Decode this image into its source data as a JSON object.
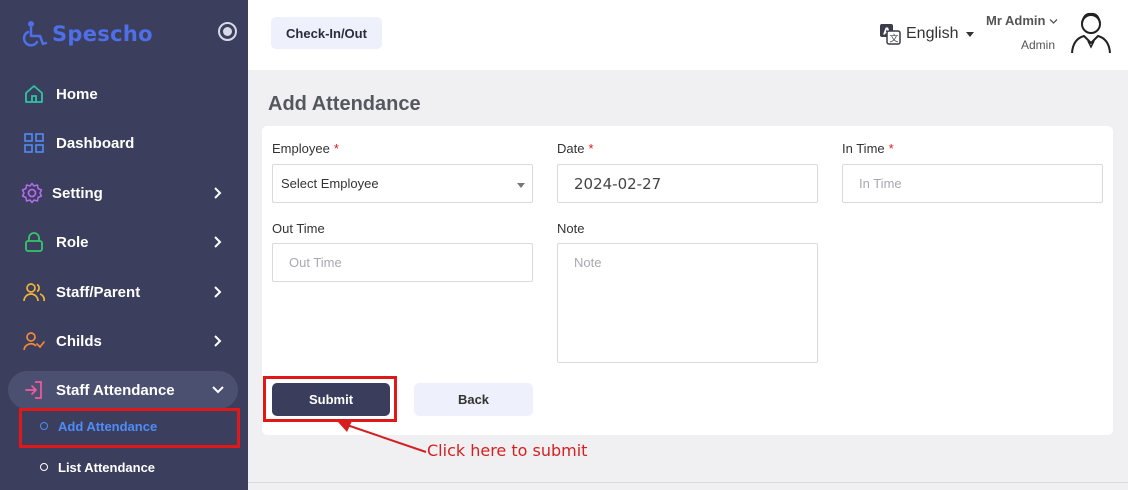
{
  "brand": {
    "name": "Spescho",
    "logo_icon": "wheelchair-icon",
    "accent": "#4f6fe8"
  },
  "sidebar": {
    "items": [
      {
        "label": "Home",
        "icon": "home-icon",
        "color": "#2ec4a6"
      },
      {
        "label": "Dashboard",
        "icon": "grid-icon",
        "color": "#4f8cf7"
      },
      {
        "label": "Setting",
        "icon": "gear-icon",
        "color": "#b26cf0"
      },
      {
        "label": "Role",
        "icon": "lock-icon",
        "color": "#34c66b"
      },
      {
        "label": "Staff/Parent",
        "icon": "users-icon",
        "color": "#f2b43a"
      },
      {
        "label": "Childs",
        "icon": "child-icon",
        "color": "#f28a3a"
      },
      {
        "label": "Staff Attendance",
        "icon": "login-icon",
        "color": "#f25aa0"
      }
    ],
    "sub_items": [
      {
        "label": "Add Attendance",
        "state": "current"
      },
      {
        "label": "List Attendance",
        "state": "default"
      }
    ]
  },
  "header": {
    "checkin_label": "Check-In/Out",
    "language": "English",
    "user_name": "Mr Admin",
    "user_role": "Admin"
  },
  "page": {
    "title": "Add Attendance"
  },
  "form": {
    "employee": {
      "label": "Employee",
      "required": "*",
      "value": "Select Employee"
    },
    "date": {
      "label": "Date",
      "required": "*",
      "value": "2024-02-27"
    },
    "in_time": {
      "label": "In Time",
      "required": "*",
      "placeholder": "In Time"
    },
    "out_time": {
      "label": "Out Time",
      "placeholder": "Out Time"
    },
    "note": {
      "label": "Note",
      "placeholder": "Note"
    },
    "submit_label": "Submit",
    "back_label": "Back"
  },
  "annotation": {
    "text": "Click here to submit",
    "color": "#d42020"
  }
}
